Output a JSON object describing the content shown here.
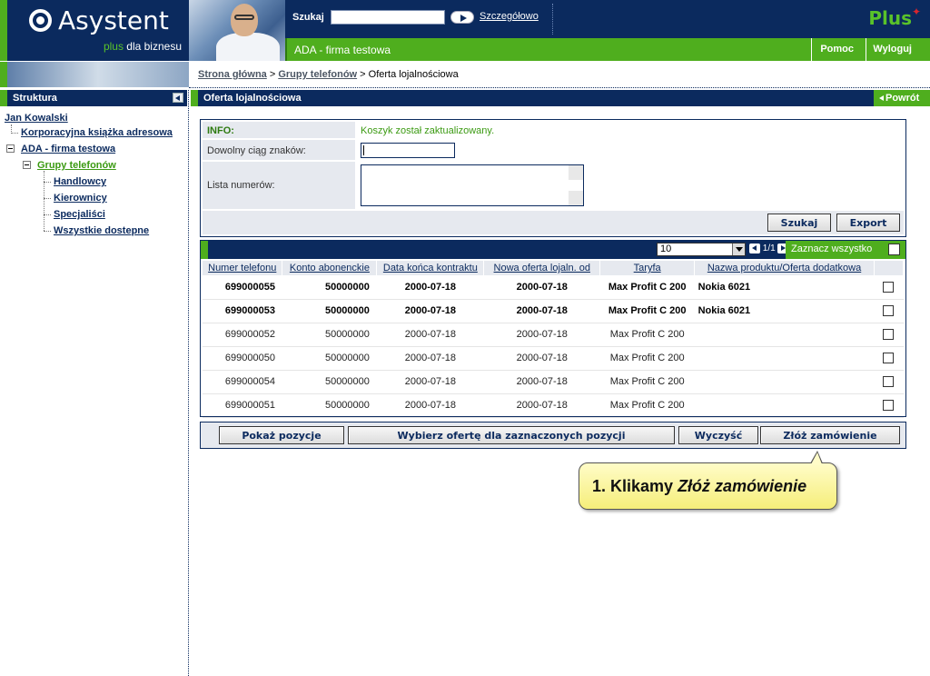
{
  "header": {
    "brand": "Asystent",
    "tagline_plus": "plus",
    "tagline_rest": " dla biznesu",
    "search_label": "Szukaj",
    "search_value": "",
    "detail_link": "Szczegółowo",
    "operator_logo": "Plus",
    "company": "ADA - firma testowa",
    "help": "Pomoc",
    "logout": "Wyloguj"
  },
  "breadcrumb": {
    "home": "Strona główna",
    "sep": " > ",
    "groups": "Grupy telefonów",
    "current": "Oferta lojalnościowa"
  },
  "sidebar": {
    "title": "Struktura",
    "tree": {
      "user": "Jan Kowalski",
      "address_book": "Korporacyjna książka adresowa",
      "company": "ADA - firma testowa",
      "groups": "Grupy telefonów",
      "children": [
        "Handlowcy",
        "Kierownicy",
        "Specjaliści",
        "Wszystkie dostepne"
      ]
    }
  },
  "main": {
    "title": "Oferta lojalnościowa",
    "back": "Powrót"
  },
  "form": {
    "info_label": "INFO:",
    "info_text": "Koszyk został zaktualizowany.",
    "text_label": "Dowolny ciąg znaków:",
    "text_value": "",
    "list_label": "Lista numerów:",
    "list_value": "",
    "search_button": "Szukaj",
    "export_button": "Export"
  },
  "table": {
    "page_size": "10",
    "pager": "1/1",
    "select_all": "Zaznacz wszystko",
    "columns": [
      "Numer telefonu",
      "Konto abonenckie",
      "Data końca kontraktu",
      "Nowa oferta lojaln. od",
      "Taryfa",
      "Nazwa produktu/Oferta dodatkowa"
    ],
    "rows": [
      {
        "phone": "699000055",
        "account": "50000000",
        "end": "2000-07-18",
        "offer_from": "2000-07-18",
        "tariff": "Max Profit C 200",
        "product": "Nokia 6021",
        "bold": true
      },
      {
        "phone": "699000053",
        "account": "50000000",
        "end": "2000-07-18",
        "offer_from": "2000-07-18",
        "tariff": "Max Profit C 200",
        "product": "Nokia 6021",
        "bold": true
      },
      {
        "phone": "699000052",
        "account": "50000000",
        "end": "2000-07-18",
        "offer_from": "2000-07-18",
        "tariff": "Max Profit C 200",
        "product": "",
        "bold": false
      },
      {
        "phone": "699000050",
        "account": "50000000",
        "end": "2000-07-18",
        "offer_from": "2000-07-18",
        "tariff": "Max Profit C 200",
        "product": "",
        "bold": false
      },
      {
        "phone": "699000054",
        "account": "50000000",
        "end": "2000-07-18",
        "offer_from": "2000-07-18",
        "tariff": "Max Profit C 200",
        "product": "",
        "bold": false
      },
      {
        "phone": "699000051",
        "account": "50000000",
        "end": "2000-07-18",
        "offer_from": "2000-07-18",
        "tariff": "Max Profit C 200",
        "product": "",
        "bold": false
      }
    ]
  },
  "actions": {
    "show": "Pokaż pozycje",
    "choose_offer": "Wybierz ofertę dla zaznaczonych pozycji",
    "clear": "Wyczyść",
    "order": "Złóż zamówienie"
  },
  "callout": {
    "prefix": "1. Klikamy ",
    "emphasis": "Złóż zamówienie"
  },
  "colors": {
    "navy": "#0b2a5e",
    "green": "#4fae1e",
    "callout": "#f6ee7a"
  }
}
